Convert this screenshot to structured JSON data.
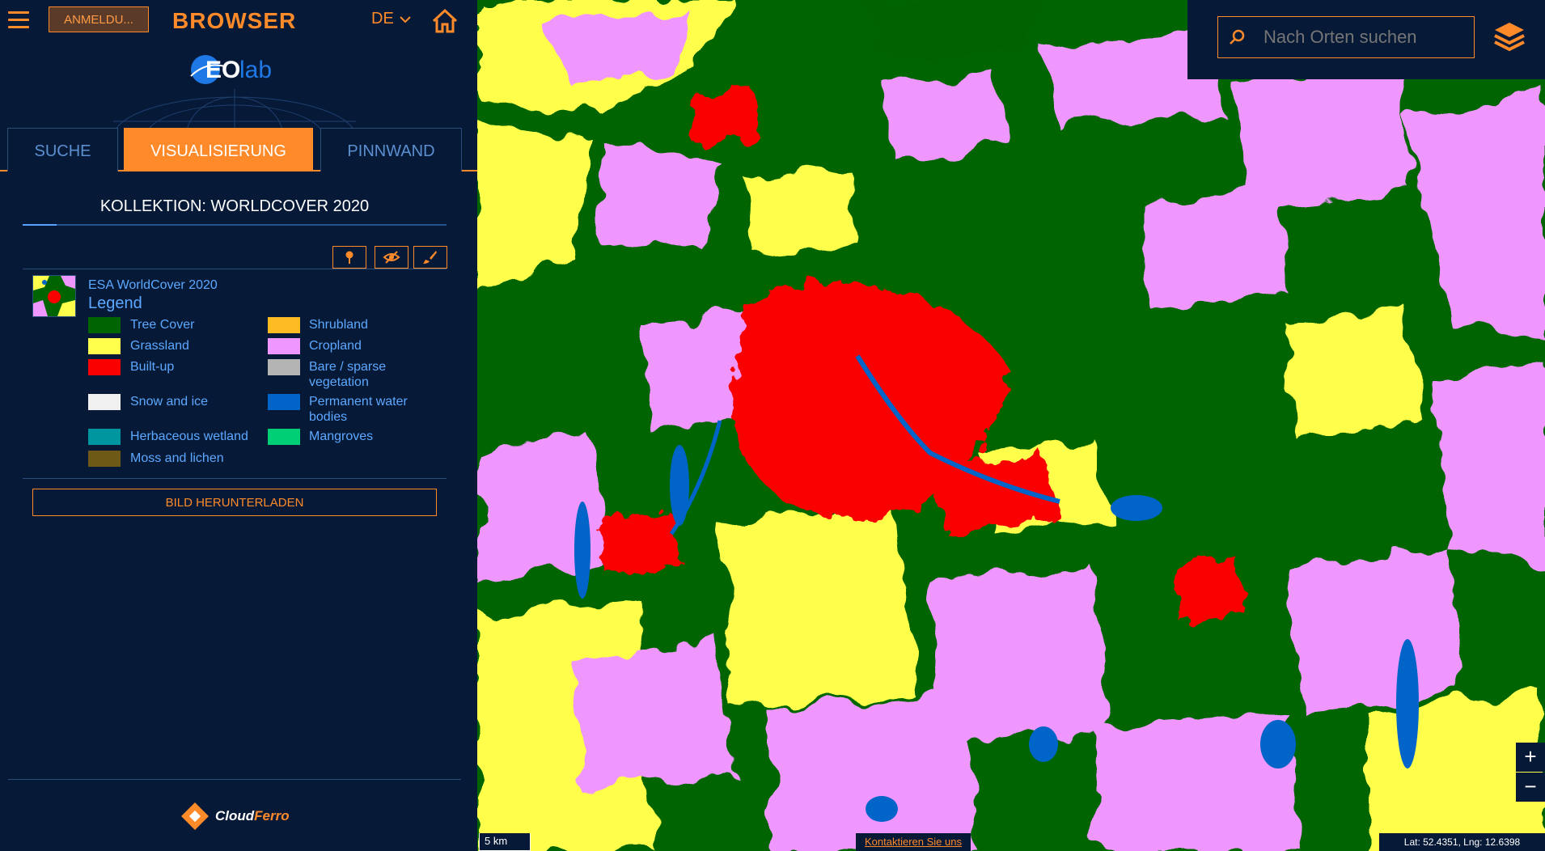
{
  "header": {
    "login_label": "ANMELDU...",
    "brand_title": "BROWSER",
    "language": "DE",
    "logo_text_eo": "EO",
    "logo_text_lab": "lab"
  },
  "tabs": [
    {
      "label": "SUCHE"
    },
    {
      "label": "VISUALISIERUNG"
    },
    {
      "label": "PINNWAND"
    }
  ],
  "collection": {
    "title": "KOLLEKTION: WORLDCOVER 2020",
    "layer_name": "ESA WorldCover 2020",
    "legend_title": "Legend",
    "legend": [
      {
        "label": "Tree Cover",
        "color": "#006400"
      },
      {
        "label": "Shrubland",
        "color": "#ffbb22"
      },
      {
        "label": "Grassland",
        "color": "#ffff4c"
      },
      {
        "label": "Cropland",
        "color": "#f096ff"
      },
      {
        "label": "Built-up",
        "color": "#fa0000"
      },
      {
        "label": "Bare / sparse vegetation",
        "color": "#b4b4b4"
      },
      {
        "label": "Snow and ice",
        "color": "#f0f0f0"
      },
      {
        "label": "Permanent water bodies",
        "color": "#0064c8"
      },
      {
        "label": "Herbaceous wetland",
        "color": "#0096a0"
      },
      {
        "label": "Mangroves",
        "color": "#00cf75"
      },
      {
        "label": "Moss and lichen",
        "color": "#6e5a16"
      }
    ],
    "download_label": "BILD HERUNTERLADEN"
  },
  "footer": {
    "brand_cloud": "Cloud",
    "brand_ferro": "Ferro"
  },
  "map": {
    "search_placeholder": "Nach Orten suchen",
    "zoom_in": "+",
    "zoom_out": "−",
    "scale": "5 km",
    "contact": "Kontaktieren Sie uns",
    "coordinates": "Lat: 52.4351, Lng: 12.6398"
  },
  "colors": {
    "accent": "#ff8a2a",
    "panel": "#061a38",
    "link": "#5da8ff"
  }
}
